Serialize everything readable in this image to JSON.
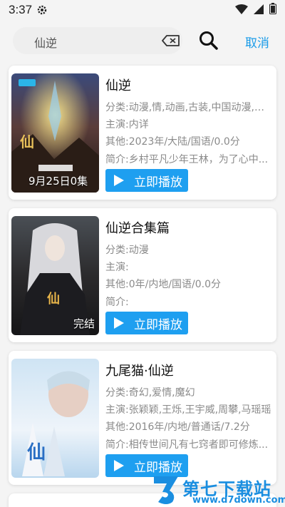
{
  "status_bar": {
    "time": "3:37"
  },
  "search": {
    "query": "仙逆",
    "cancel_label": "取消"
  },
  "results": [
    {
      "title": "仙逆",
      "category": "分类:动漫,情,动画,古装,中国动漫,国...",
      "cast": "主演:内详",
      "other": "其他:2023年/大陆/国语/0.0分",
      "intro": "简介:乡村平凡少年王林，为了心中...",
      "badge": "9月25日0集",
      "play_label": "立即播放"
    },
    {
      "title": "仙逆合集篇",
      "category": "分类:动漫",
      "cast": "主演:",
      "other": "其他:0年/内地/国语/0.0分",
      "intro": "简介:",
      "badge": "完结",
      "play_label": "立即播放"
    },
    {
      "title": "九尾猫·仙逆",
      "category": "分类:奇幻,爱情,魔幻",
      "cast": "主演:张颖颖,王烁,王宇威,周攀,马瑶瑶",
      "other": "其他:2016年/内地/普通话/7.2分",
      "intro": "简介:相传世间凡有七窍者即可修炼...",
      "badge": "",
      "play_label": "立即播放"
    }
  ],
  "watermark": {
    "name": "第七下载站",
    "url": "www.d7down.com"
  },
  "colors": {
    "accent": "#1e9ff0",
    "cancel": "#1a9be8"
  }
}
